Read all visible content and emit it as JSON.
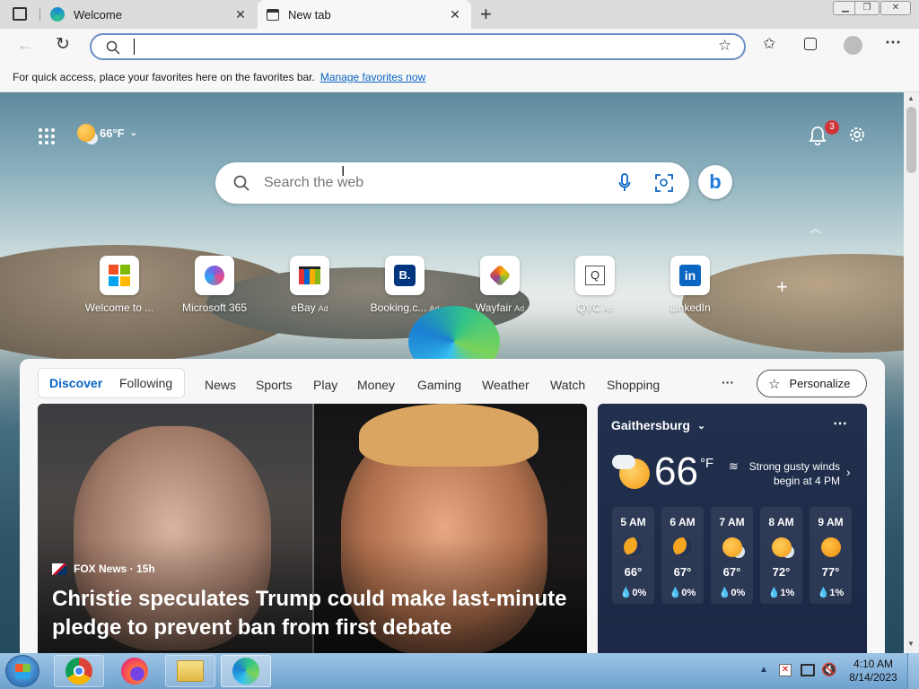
{
  "browser": {
    "tabs": [
      {
        "title": "Welcome",
        "active": false
      },
      {
        "title": "New tab",
        "active": true
      }
    ],
    "address_value": "",
    "favorites_bar": {
      "message": "For quick access, place your favorites here on the favorites bar.",
      "link": "Manage favorites now"
    }
  },
  "newtab": {
    "weather_chip": "66°F",
    "notifications_count": "3",
    "search_placeholder": "Search the web",
    "quick_links": [
      {
        "label": "Welcome to ...",
        "ad": ""
      },
      {
        "label": "Microsoft 365",
        "ad": ""
      },
      {
        "label": "eBay",
        "ad": "Ad"
      },
      {
        "label": "Booking.c...",
        "ad": "Ad"
      },
      {
        "label": "Wayfair",
        "ad": "Ad"
      },
      {
        "label": "QVC",
        "ad": "Ad"
      },
      {
        "label": "LinkedIn",
        "ad": ""
      }
    ],
    "feed_tabs": [
      "Discover",
      "Following"
    ],
    "feed_nav": [
      "News",
      "Sports",
      "Play",
      "Money",
      "Gaming",
      "Weather",
      "Watch",
      "Shopping"
    ],
    "more": "···",
    "personalize": "Personalize",
    "article": {
      "source": "FOX News · 15h",
      "headline_line1": "Christie speculates Trump could make last-minute",
      "headline_line2": "pledge to prevent ban from first debate"
    },
    "weather": {
      "location": "Gaithersburg",
      "temp": "66",
      "unit": "°F",
      "alert_line1": "Strong gusty winds",
      "alert_line2": "begin at 4 PM",
      "hourly": [
        {
          "time": "5 AM",
          "icon": "moon-icon",
          "temp": "66°",
          "precip": "0%"
        },
        {
          "time": "6 AM",
          "icon": "moon-icon",
          "temp": "67°",
          "precip": "0%"
        },
        {
          "time": "7 AM",
          "icon": "partly-sunny-icon",
          "temp": "67°",
          "precip": "0%"
        },
        {
          "time": "8 AM",
          "icon": "partly-sunny-icon",
          "temp": "72°",
          "precip": "1%"
        },
        {
          "time": "9 AM",
          "icon": "sun-icon",
          "temp": "77°",
          "precip": "1%"
        }
      ]
    }
  },
  "taskbar": {
    "clock_time": "4:10 AM",
    "clock_date": "8/14/2023"
  },
  "colors": {
    "accent": "#0b63c4",
    "weather_bg": "#1f2c49",
    "taskbar": "#7eaed8"
  }
}
